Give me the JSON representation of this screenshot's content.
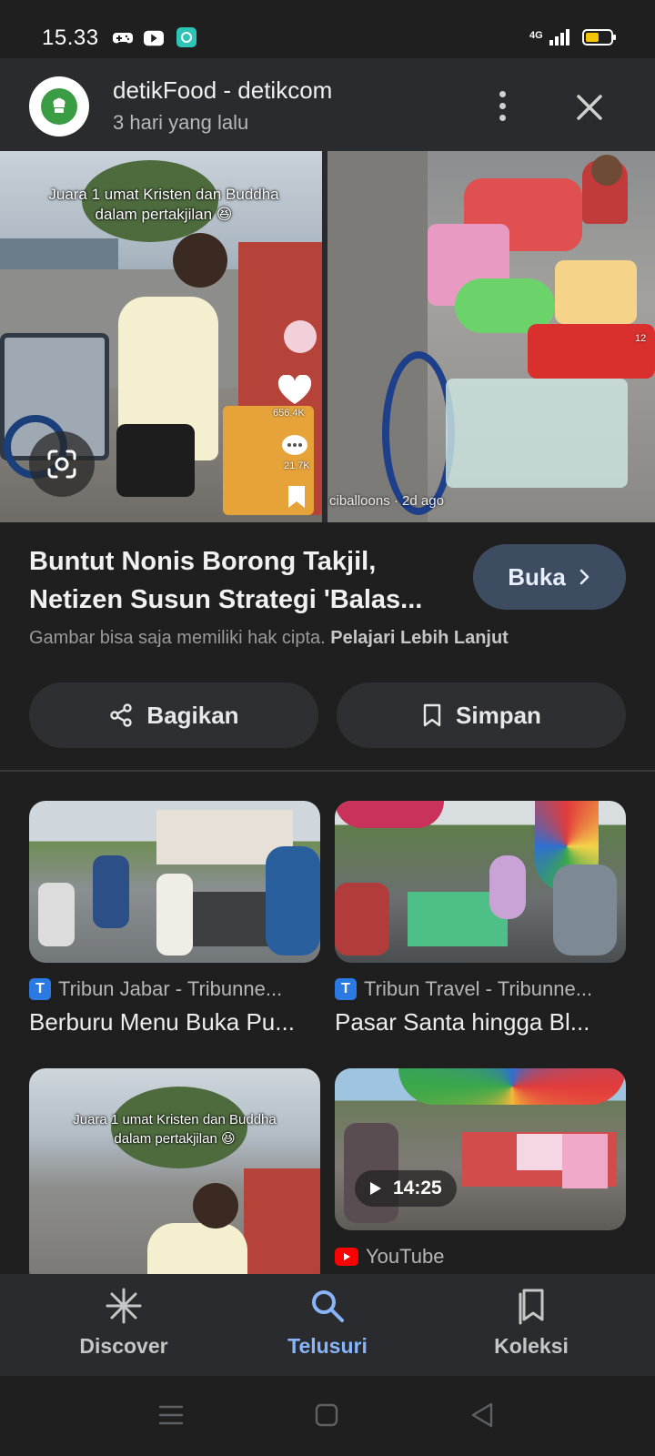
{
  "status_bar": {
    "time": "15.33",
    "network": "4G",
    "battery_level": 0.55,
    "icons": [
      "gamepad-icon",
      "youtube-icon",
      "app-icon"
    ]
  },
  "header": {
    "source_name": "detikFood - detikcom",
    "timestamp": "3 hari yang lalu"
  },
  "hero": {
    "caption_line1": "Juara 1 umat Kristen dan Buddha",
    "caption_line2": "dalam pertakjilan 😆",
    "likes": "656.4K",
    "comments": "21.7K",
    "right_side_count": "12",
    "right_meta": "ciballoons · 2d ago"
  },
  "article": {
    "title": "Buntut Nonis Borong Takjil, Netizen Susun Strategi 'Balas...",
    "open_label": "Buka",
    "copyright_text": "Gambar bisa saja memiliki hak cipta.",
    "learn_more": "Pelajari Lebih Lanjut"
  },
  "actions": {
    "share_label": "Bagikan",
    "save_label": "Simpan"
  },
  "related": [
    {
      "source": "Tribun Jabar - Tribunne...",
      "title": "Berburu Menu Buka Pu..."
    },
    {
      "source": "Tribun Travel - Tribunne...",
      "title": "Pasar Santa hingga Bl..."
    },
    {
      "source": "",
      "title": ""
    },
    {
      "source": "YouTube",
      "title": "",
      "duration": "14:25"
    }
  ],
  "third_thumb_caption": {
    "line1": "Juara 1 umat Kristen dan Buddha",
    "line2": "dalam pertakjilan 😆"
  },
  "bottom_nav": {
    "discover": "Discover",
    "search": "Telusuri",
    "collections": "Koleksi",
    "active": "search",
    "active_color": "#8ab4f8",
    "inactive_color": "#c4c7c5"
  }
}
